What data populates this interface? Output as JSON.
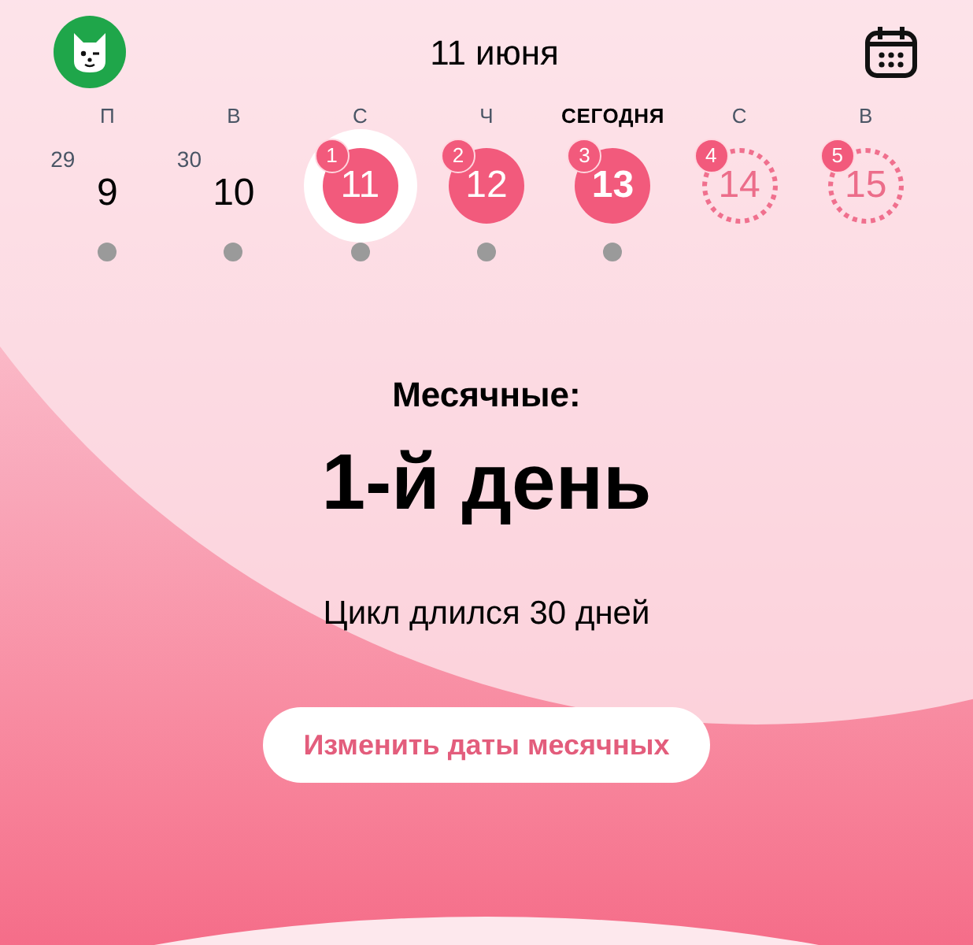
{
  "header": {
    "title": "11 июня"
  },
  "days": [
    {
      "weekday": "П",
      "weekday_today": false,
      "kind": "plain",
      "number": "9",
      "prev": "29",
      "selected": false,
      "today": false,
      "dot": true
    },
    {
      "weekday": "В",
      "weekday_today": false,
      "kind": "plain",
      "number": "10",
      "prev": "30",
      "selected": false,
      "today": false,
      "dot": true
    },
    {
      "weekday": "С",
      "weekday_today": false,
      "kind": "period",
      "number": "11",
      "badge": "1",
      "selected": true,
      "today": false,
      "dot": true
    },
    {
      "weekday": "Ч",
      "weekday_today": false,
      "kind": "period",
      "number": "12",
      "badge": "2",
      "selected": false,
      "today": false,
      "dot": true
    },
    {
      "weekday": "СЕГОДНЯ",
      "weekday_today": true,
      "kind": "period",
      "number": "13",
      "badge": "3",
      "selected": false,
      "today": true,
      "dot": true
    },
    {
      "weekday": "С",
      "weekday_today": false,
      "kind": "predicted",
      "number": "14",
      "badge": "4",
      "selected": false,
      "today": false,
      "dot": false
    },
    {
      "weekday": "В",
      "weekday_today": false,
      "kind": "predicted",
      "number": "15",
      "badge": "5",
      "selected": false,
      "today": false,
      "dot": false
    }
  ],
  "status": {
    "label": "Месячные:",
    "value": "1-й день",
    "note": "Цикл длился 30 дней"
  },
  "action_button": "Изменить даты месячных"
}
